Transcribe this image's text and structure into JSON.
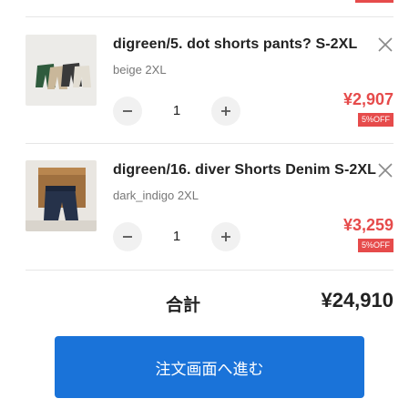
{
  "items": [
    {
      "title": "digreen/5. dot shorts pants? S-2XL",
      "variant": "beige 2XL",
      "quantity": "1",
      "price": "¥2,907",
      "discount": "5%OFF"
    },
    {
      "title": "digreen/16. diver Shorts Denim S-2XL",
      "variant": "dark_indigo 2XL",
      "quantity": "1",
      "price": "¥3,259",
      "discount": "5%OFF"
    }
  ],
  "summary": {
    "total_label": "合計",
    "total_value": "¥24,910"
  },
  "checkout": {
    "label": "注文画面へ進む"
  },
  "colors": {
    "price": "#e64b4b",
    "checkout_bg": "#1a73d9"
  },
  "icons": {
    "remove": "close-icon",
    "decrement": "minus-icon",
    "increment": "plus-icon"
  }
}
